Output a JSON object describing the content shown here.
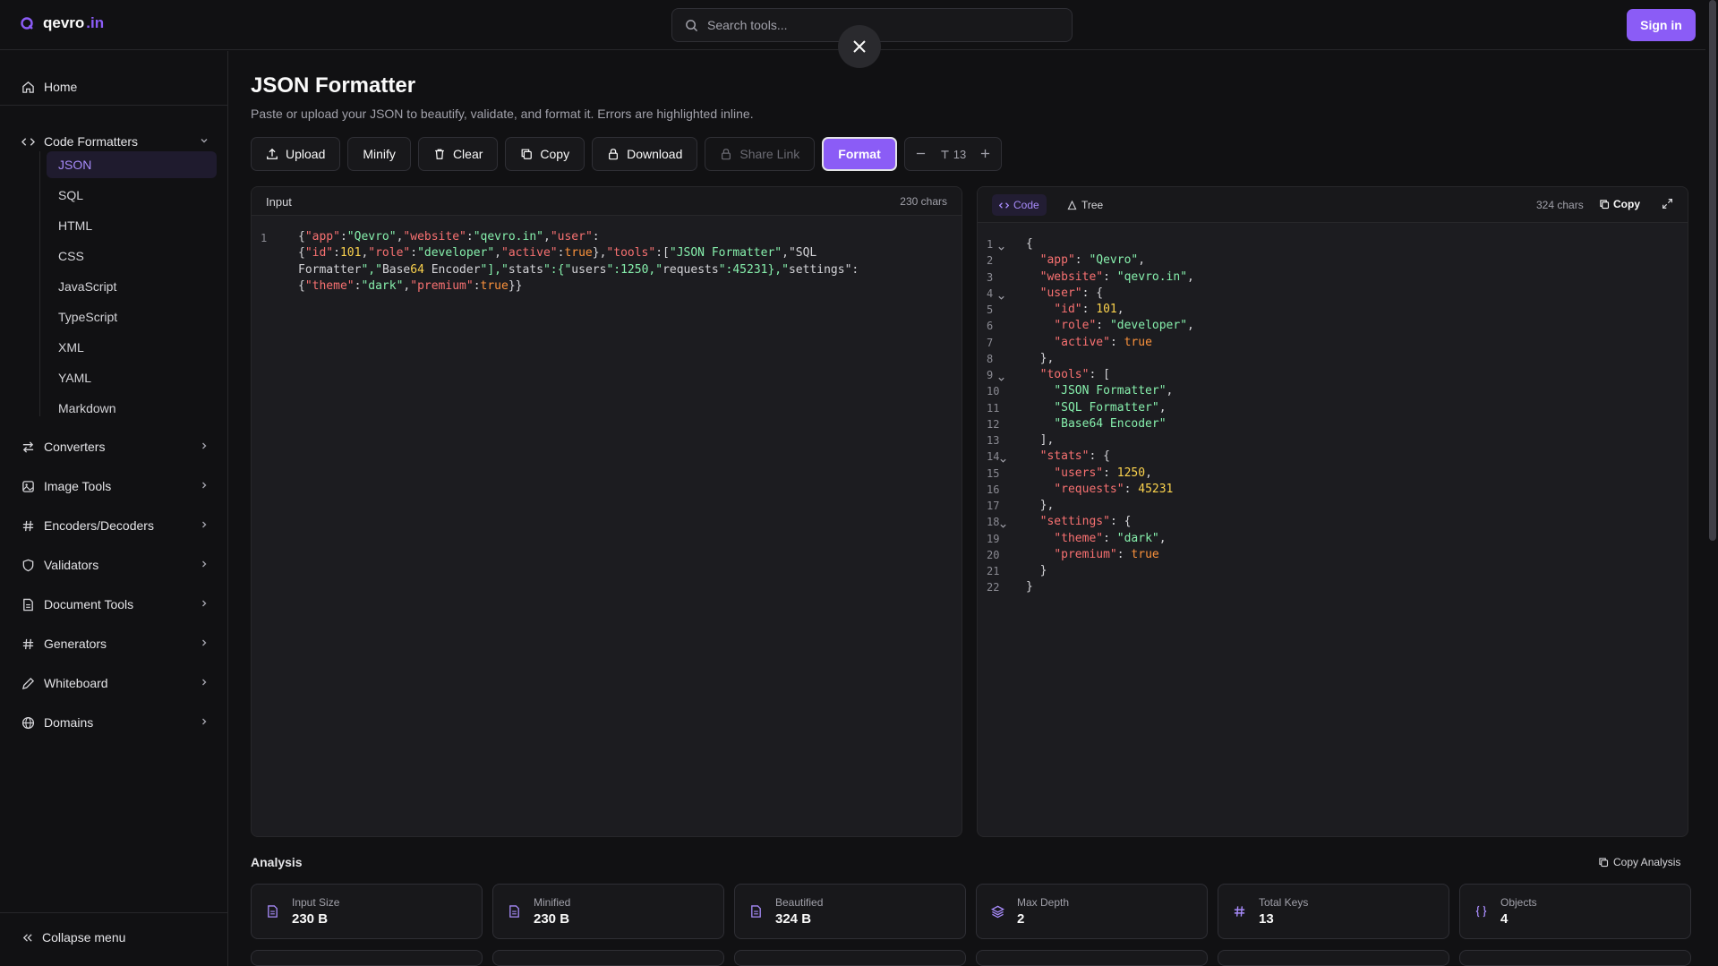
{
  "brand": {
    "name": "qevro",
    "suffix": ".in"
  },
  "search": {
    "placeholder": "Search tools..."
  },
  "header": {
    "signin_label": "Sign in"
  },
  "colors": {
    "accent": "#8b5cf6",
    "background": "#111113"
  },
  "sidebar": {
    "home": "Home",
    "code_formatters": "Code Formatters",
    "sub_items": [
      "JSON",
      "SQL",
      "HTML",
      "CSS",
      "JavaScript",
      "TypeScript",
      "XML",
      "YAML",
      "Markdown"
    ],
    "groups": [
      "Converters",
      "Image Tools",
      "Encoders/Decoders",
      "Validators",
      "Document Tools",
      "Generators",
      "Whiteboard",
      "Domains"
    ],
    "collapse_label": "Collapse menu"
  },
  "page": {
    "title": "JSON Formatter",
    "description": "Paste or upload your JSON to beautify, validate, and format it. Errors are highlighted inline."
  },
  "toolbar": {
    "upload": "Upload",
    "minify": "Minify",
    "clear": "Clear",
    "copy": "Copy",
    "download": "Download",
    "share": "Share Link",
    "format": "Format",
    "font_size": "13"
  },
  "input_panel": {
    "label": "Input",
    "chars": "230 chars",
    "line_number": "1",
    "lines": [
      "{\"app\":\"Qevro\",\"website\":\"qevro.in\",\"user\":",
      "{\"id\":101,\"role\":\"developer\",\"active\":true},\"tools\":[\"JSON Formatter\",\"SQL",
      "Formatter\",\"Base64 Encoder\"],\"stats\":{\"users\":1250,\"requests\":45231},\"settings\":",
      "{\"theme\":\"dark\",\"premium\":true}}"
    ]
  },
  "output_panel": {
    "tab_code": "Code",
    "tab_tree": "Tree",
    "chars": "324 chars",
    "copy_label": "Copy",
    "lines": [
      "{",
      "  \"app\": \"Qevro\",",
      "  \"website\": \"qevro.in\",",
      "  \"user\": {",
      "    \"id\": 101,",
      "    \"role\": \"developer\",",
      "    \"active\": true",
      "  },",
      "  \"tools\": [",
      "    \"JSON Formatter\",",
      "    \"SQL Formatter\",",
      "    \"Base64 Encoder\"",
      "  ],",
      "  \"stats\": {",
      "    \"users\": 1250,",
      "    \"requests\": 45231",
      "  },",
      "  \"settings\": {",
      "    \"theme\": \"dark\",",
      "    \"premium\": true",
      "  }",
      "}"
    ],
    "foldable_lines": [
      1,
      4,
      9,
      14,
      18
    ]
  },
  "analysis": {
    "title": "Analysis",
    "copy_label": "Copy Analysis",
    "stats": [
      {
        "label": "Input Size",
        "value": "230 B",
        "icon": "file-icon"
      },
      {
        "label": "Minified",
        "value": "230 B",
        "icon": "file-icon"
      },
      {
        "label": "Beautified",
        "value": "324 B",
        "icon": "file-icon"
      },
      {
        "label": "Max Depth",
        "value": "2",
        "icon": "layers-icon"
      },
      {
        "label": "Total Keys",
        "value": "13",
        "icon": "hash-icon"
      },
      {
        "label": "Objects",
        "value": "4",
        "icon": "braces-icon"
      }
    ]
  }
}
